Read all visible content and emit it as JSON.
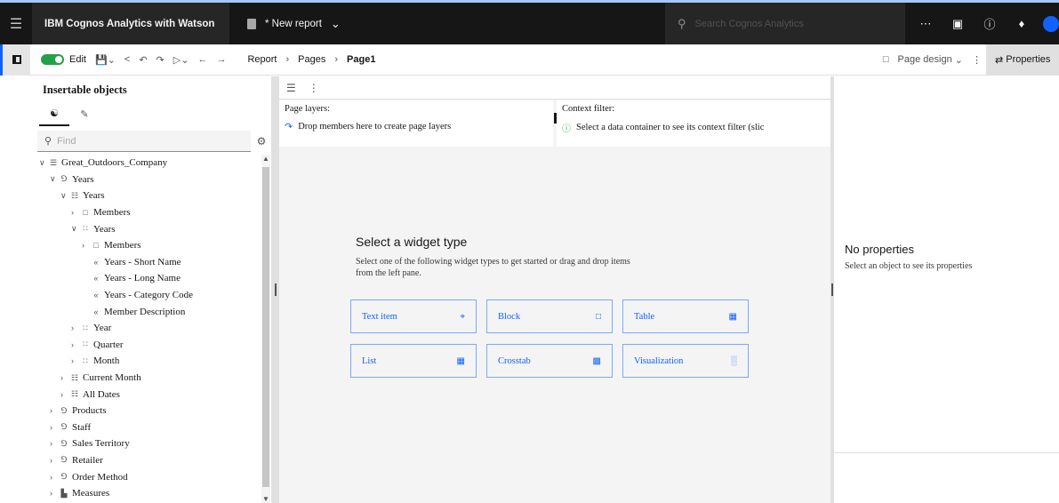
{
  "header": {
    "app_title": "IBM Cognos Analytics with Watson",
    "report_tab": "* New report",
    "search_placeholder": "Search Cognos Analytics"
  },
  "toolbar": {
    "edit_label": "Edit",
    "breadcrumb": [
      "Report",
      "Pages",
      "Page1"
    ],
    "page_design_label": "Page design",
    "properties_label": "Properties"
  },
  "left_panel": {
    "title": "Insertable objects",
    "find_placeholder": "Find",
    "tree": [
      {
        "caret": "v",
        "icon": "package",
        "label": "Great_Outdoors_Company",
        "level": 0
      },
      {
        "caret": "v",
        "icon": "dimension",
        "label": "Years",
        "level": 1
      },
      {
        "caret": "v",
        "icon": "hierarchy",
        "label": "Years",
        "level": 2
      },
      {
        "caret": ">",
        "icon": "folder",
        "label": "Members",
        "level": 3
      },
      {
        "caret": "v",
        "icon": "level",
        "label": "Years",
        "level": 3
      },
      {
        "caret": ">",
        "icon": "folder",
        "label": "Members",
        "level": 4
      },
      {
        "caret": "",
        "icon": "attribute",
        "label": "Years - Short Name",
        "level": 4
      },
      {
        "caret": "",
        "icon": "attribute",
        "label": "Years - Long Name",
        "level": 4
      },
      {
        "caret": "",
        "icon": "attribute",
        "label": "Years - Category Code",
        "level": 4
      },
      {
        "caret": "",
        "icon": "attribute",
        "label": "Member Description",
        "level": 4
      },
      {
        "caret": ">",
        "icon": "level",
        "label": "Year",
        "level": 3
      },
      {
        "caret": ">",
        "icon": "level",
        "label": "Quarter",
        "level": 3
      },
      {
        "caret": ">",
        "icon": "level",
        "label": "Month",
        "level": 3
      },
      {
        "caret": ">",
        "icon": "hierarchy",
        "label": "Current Month",
        "level": 2
      },
      {
        "caret": ">",
        "icon": "hierarchy",
        "label": "All Dates",
        "level": 2
      },
      {
        "caret": ">",
        "icon": "dimension",
        "label": "Products",
        "level": 1
      },
      {
        "caret": ">",
        "icon": "dimension",
        "label": "Staff",
        "level": 1
      },
      {
        "caret": ">",
        "icon": "dimension",
        "label": "Sales Territory",
        "level": 1
      },
      {
        "caret": ">",
        "icon": "dimension",
        "label": "Retailer",
        "level": 1
      },
      {
        "caret": ">",
        "icon": "dimension",
        "label": "Order Method",
        "level": 1
      },
      {
        "caret": ">",
        "icon": "measures",
        "label": "Measures",
        "level": 1
      }
    ]
  },
  "canvas": {
    "page_layers_label": "Page layers:",
    "page_layers_hint": "Drop members here to create page layers",
    "context_filter_label": "Context filter:",
    "context_filter_hint": "Select a data container to see its context filter (slic",
    "widget_heading": "Select a widget type",
    "widget_desc": "Select one of the following widget types to get started or drag and drop items from the left pane.",
    "widgets": [
      {
        "label": "Text item",
        "icon": "text-item-icon"
      },
      {
        "label": "Block",
        "icon": "block-icon"
      },
      {
        "label": "Table",
        "icon": "table-icon"
      },
      {
        "label": "List",
        "icon": "list-icon"
      },
      {
        "label": "Crosstab",
        "icon": "crosstab-icon"
      },
      {
        "label": "Visualization",
        "icon": "visualization-icon"
      }
    ]
  },
  "right_panel": {
    "title": "No properties",
    "subtitle": "Select an object to see its properties"
  }
}
